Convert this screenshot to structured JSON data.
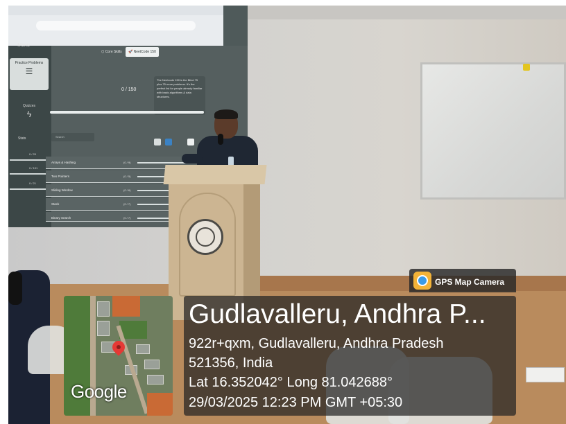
{
  "screen": {
    "menu_title": "Menu",
    "sidebar_items": [
      {
        "label": "Practice Problems",
        "icon": "list-icon",
        "active": true
      },
      {
        "label": "Quizzes",
        "icon": "lightning-icon",
        "active": false
      }
    ],
    "stats_label": "Stats",
    "stat_counts": [
      "0 / 20",
      "0 / 101",
      "0 / 21"
    ],
    "tabs": [
      {
        "label": "Core Skills",
        "icon": "cube-icon",
        "active": false
      },
      {
        "label": "NeetCode 150",
        "icon": "rocket-icon",
        "active": true
      }
    ],
    "progress_label": "0 / 150",
    "info_text": "The Neetcode 150 is the Blind 75 plus 75 more problems. It's the perfect list for people already familiar with basic algorithms & data structures.",
    "search_placeholder": "Search",
    "topics": [
      {
        "name": "Arrays & Hashing",
        "count": "(0 / 9)"
      },
      {
        "name": "Two Pointers",
        "count": "(0 / 5)"
      },
      {
        "name": "Sliding Window",
        "count": "(0 / 6)"
      },
      {
        "name": "Stack",
        "count": "(0 / 7)"
      },
      {
        "name": "Binary Search",
        "count": "(0 / 7)"
      }
    ]
  },
  "gps_overlay": {
    "app_name": "GPS Map Camera",
    "app_icon": "gps-camera-icon",
    "place_title": "Gudlavalleru, Andhra P...",
    "address_line1": "922r+qxm, Gudlavalleru, Andhra Pradesh",
    "address_line2": "521356, India",
    "coordinates": "Lat 16.352042° Long 81.042688°",
    "datetime": "29/03/2025 12:23 PM GMT +05:30",
    "map_provider": "Google",
    "pin_icon": "map-pin-icon",
    "pin_color": "#e53935"
  }
}
